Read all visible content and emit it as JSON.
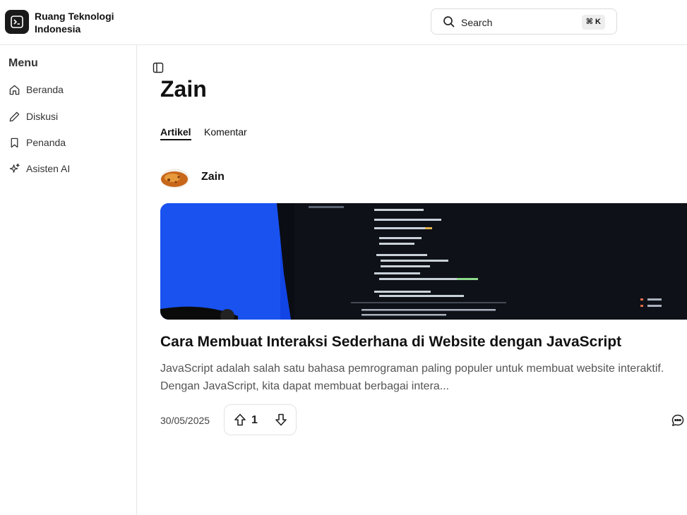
{
  "brand": {
    "line1": "Ruang Teknologi",
    "line2": "Indonesia",
    "logo_icon": "terminal-icon"
  },
  "search": {
    "label": "Search",
    "shortcut": "⌘ K",
    "icon": "search-icon"
  },
  "sidebar": {
    "title": "Menu",
    "items": [
      {
        "label": "Beranda",
        "icon": "home-icon"
      },
      {
        "label": "Diskusi",
        "icon": "pencil-icon"
      },
      {
        "label": "Penanda",
        "icon": "bookmark-icon"
      },
      {
        "label": "Asisten AI",
        "icon": "sparkles-icon"
      }
    ]
  },
  "profile": {
    "name": "Zain",
    "tabs": [
      {
        "label": "Artikel",
        "active": true
      },
      {
        "label": "Komentar",
        "active": false
      }
    ]
  },
  "article": {
    "author": "Zain",
    "title": "Cara Membuat Interaksi Sederhana di Website dengan JavaScript",
    "excerpt": "JavaScript adalah salah satu bahasa pemrograman paling populer untuk membuat website interaktif. Dengan JavaScript, kita dapat membuat berbagai intera...",
    "date": "30/05/2025",
    "votes": "1"
  },
  "colors": {
    "accent": "#111111",
    "cover_blue": "#1245e6",
    "border": "#e6e6e6"
  }
}
